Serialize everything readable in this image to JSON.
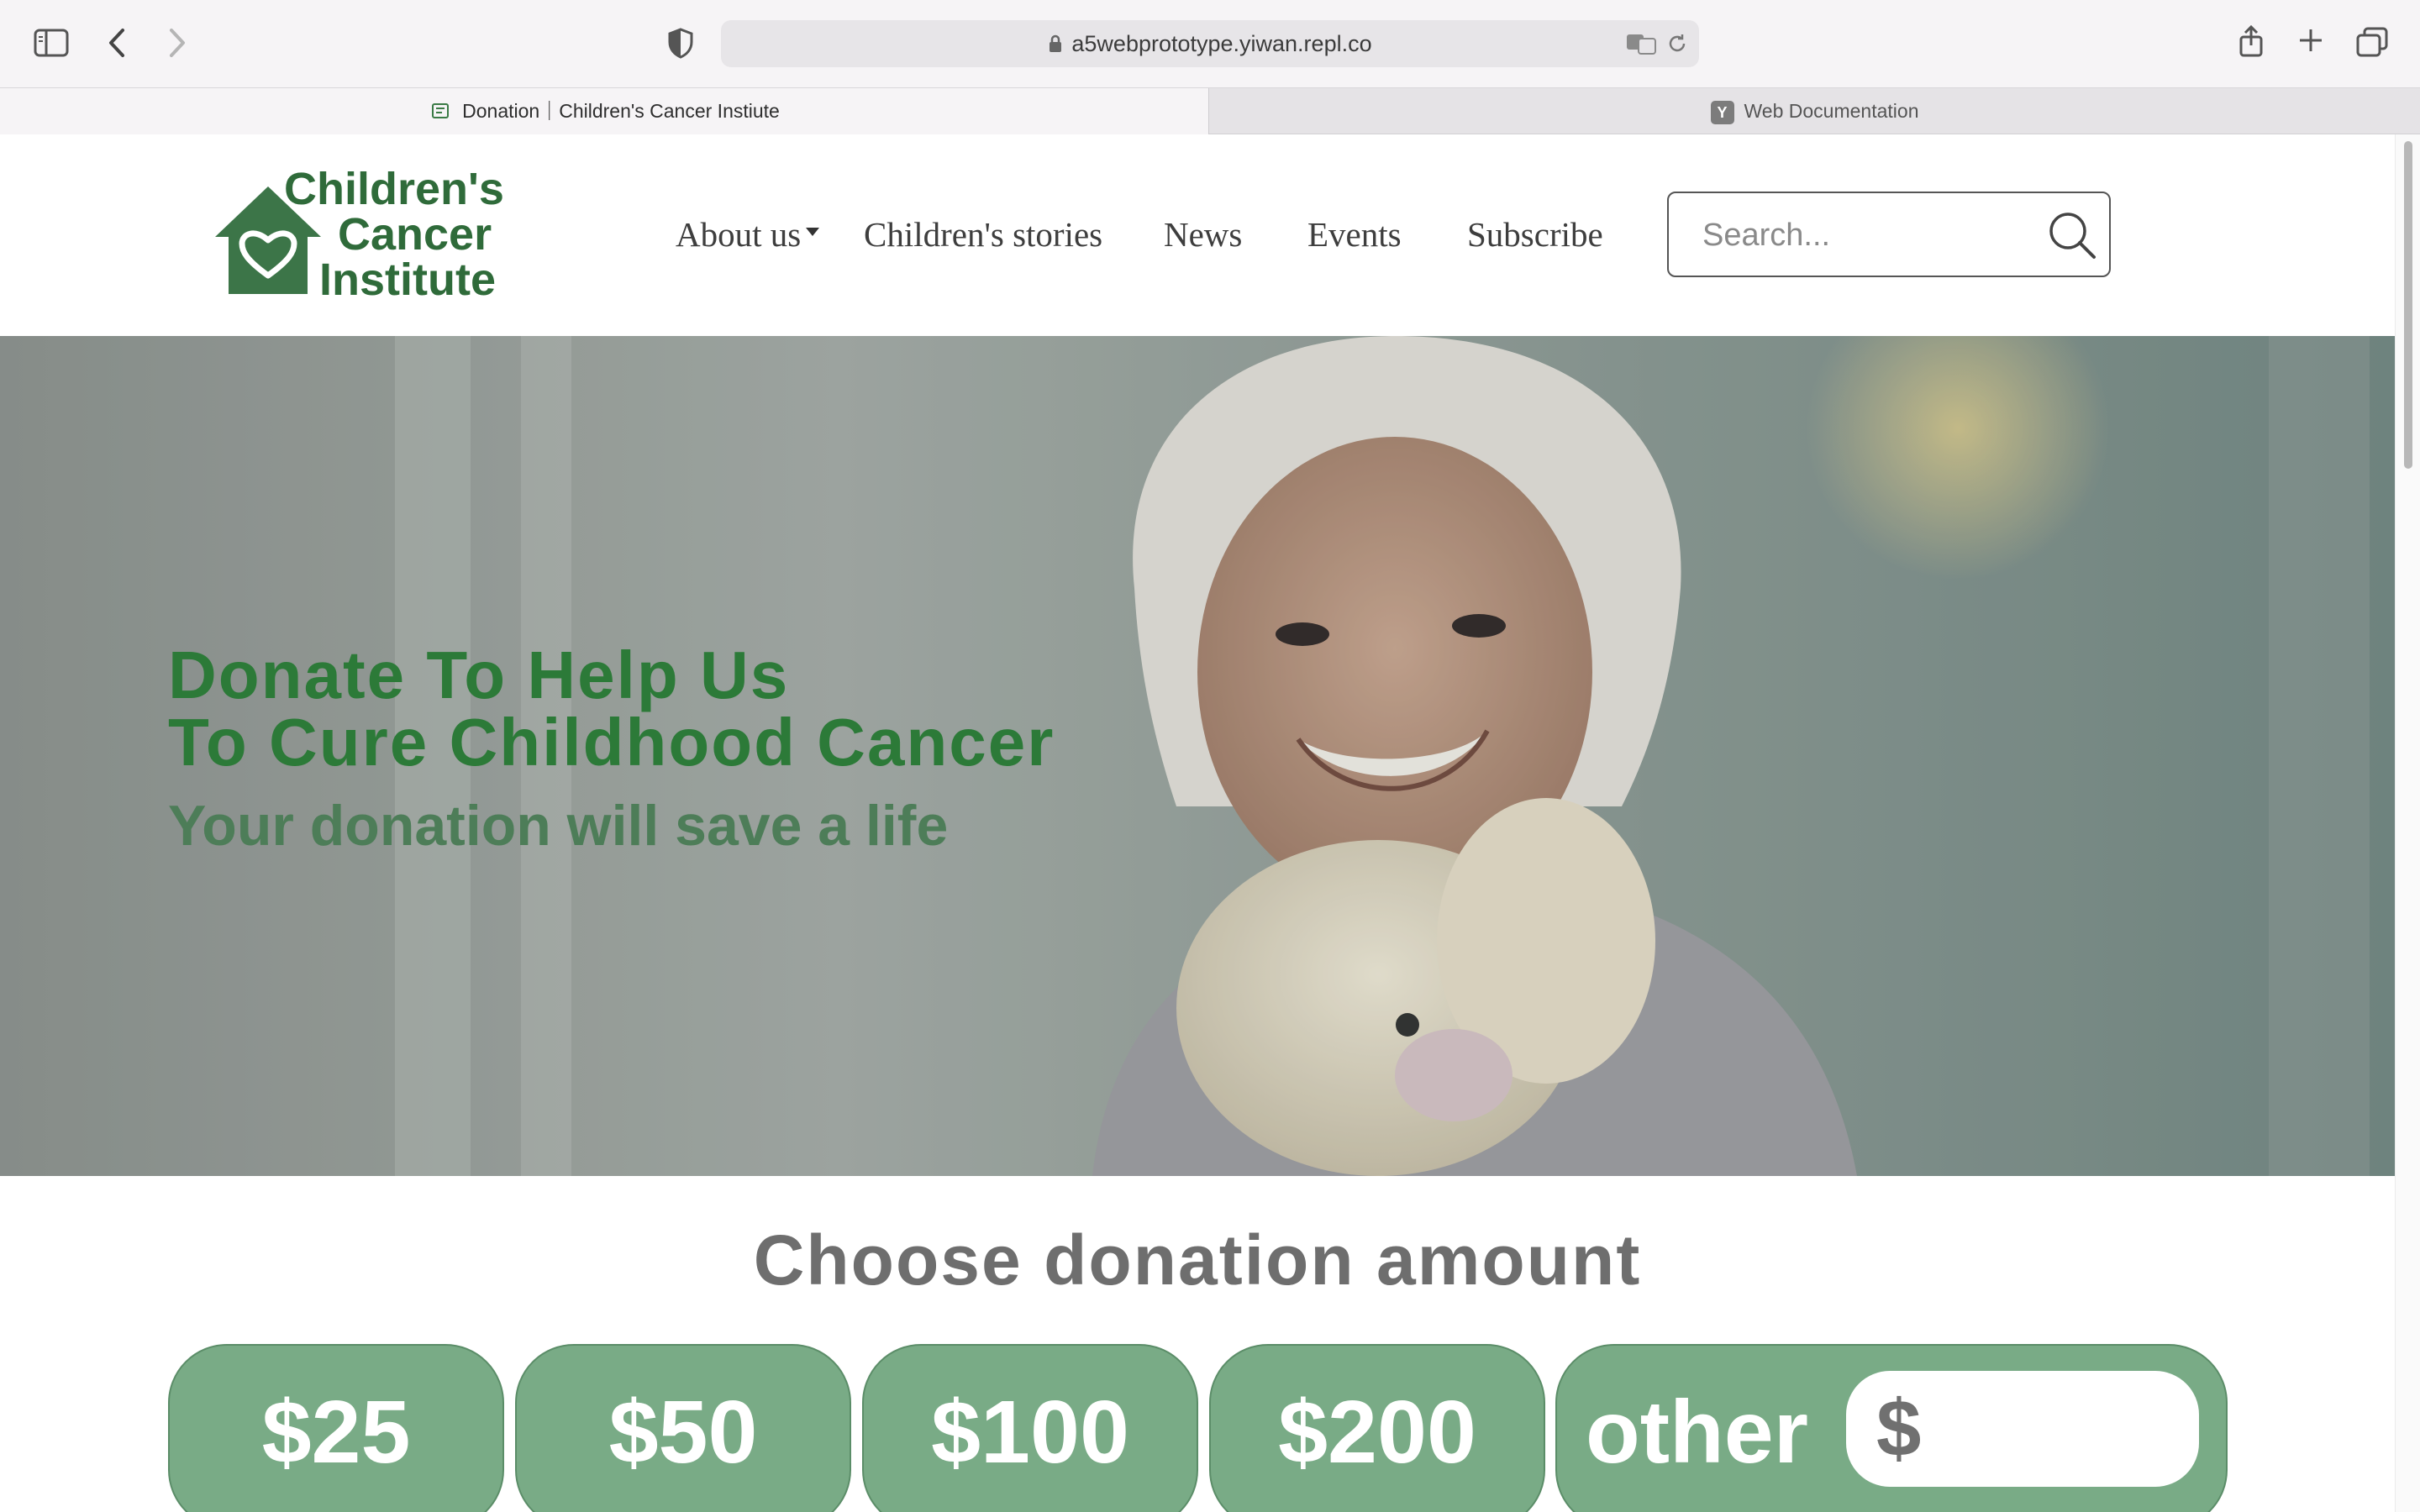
{
  "browser": {
    "url": "a5webprototype.yiwan.repl.co",
    "tabs": [
      {
        "label": "Donation｜Children's Cancer Instiute",
        "favicon": "page-icon"
      },
      {
        "label": "Web Documentation",
        "favicon": "Y"
      }
    ]
  },
  "site": {
    "logo": {
      "line1": "Children's",
      "line2": "Cancer",
      "line3": "Institute",
      "color": "#2f6b3a"
    },
    "nav": {
      "about": "About us",
      "stories": "Children's stories",
      "news": "News",
      "events": "Events",
      "subscribe": "Subscribe"
    },
    "search": {
      "placeholder": "Search..."
    }
  },
  "hero": {
    "title": "Donate To Help Us\nTo Cure Childhood Cancer",
    "subtitle": "Your donation will save a life"
  },
  "donation": {
    "heading": "Choose donation amount",
    "amounts": [
      "$25",
      "$50",
      "$100",
      "$200"
    ],
    "other_label": "other",
    "currency": "$",
    "accent": "#79ab86"
  }
}
